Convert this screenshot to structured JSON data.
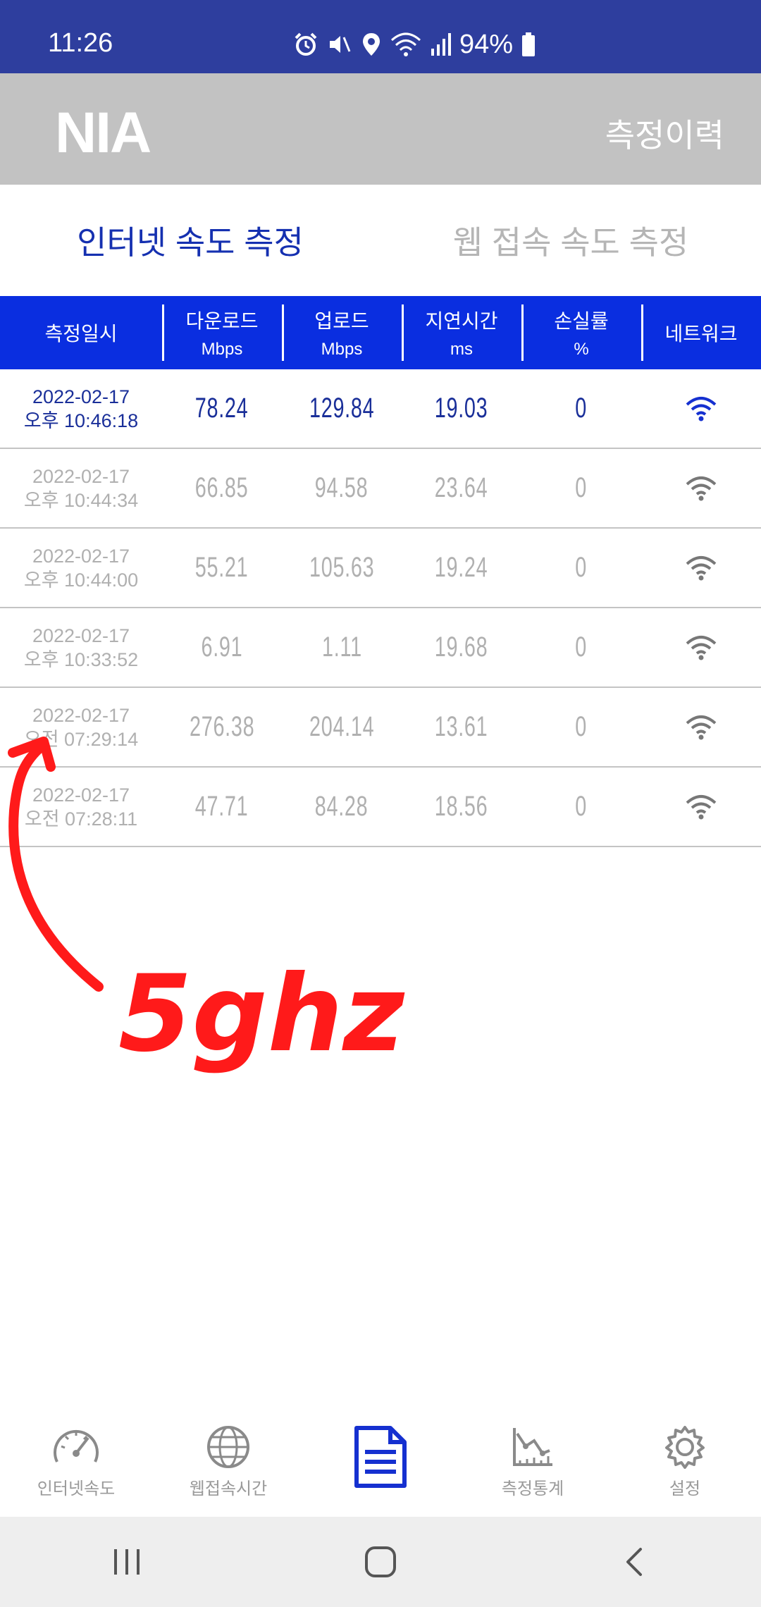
{
  "status_bar": {
    "time": "11:26",
    "battery": "94%",
    "icons": [
      "alarm-icon",
      "mute-icon",
      "location-icon",
      "wifi-icon",
      "signal-icon",
      "battery-icon"
    ]
  },
  "header": {
    "logo": "NIA",
    "title": "측정이력"
  },
  "tabs": [
    {
      "label": "인터넷 속도 측정",
      "active": true
    },
    {
      "label": "웹 접속 속도 측정",
      "active": false
    }
  ],
  "table": {
    "columns": [
      {
        "label": "측정일시",
        "unit": ""
      },
      {
        "label": "다운로드",
        "unit": "Mbps"
      },
      {
        "label": "업로드",
        "unit": "Mbps"
      },
      {
        "label": "지연시간",
        "unit": "ms"
      },
      {
        "label": "손실률",
        "unit": "%"
      },
      {
        "label": "네트워크",
        "unit": ""
      }
    ],
    "rows": [
      {
        "date": "2022-02-17",
        "time": "오후 10:46:18",
        "download": "78.24",
        "upload": "129.84",
        "latency": "19.03",
        "loss": "0",
        "network": "wifi-icon",
        "active": true
      },
      {
        "date": "2022-02-17",
        "time": "오후 10:44:34",
        "download": "66.85",
        "upload": "94.58",
        "latency": "23.64",
        "loss": "0",
        "network": "wifi-icon",
        "active": false
      },
      {
        "date": "2022-02-17",
        "time": "오후 10:44:00",
        "download": "55.21",
        "upload": "105.63",
        "latency": "19.24",
        "loss": "0",
        "network": "wifi-icon",
        "active": false
      },
      {
        "date": "2022-02-17",
        "time": "오후 10:33:52",
        "download": "6.91",
        "upload": "1.11",
        "latency": "19.68",
        "loss": "0",
        "network": "wifi-icon",
        "active": false
      },
      {
        "date": "2022-02-17",
        "time": "오전 07:29:14",
        "download": "276.38",
        "upload": "204.14",
        "latency": "13.61",
        "loss": "0",
        "network": "wifi-icon",
        "active": false
      },
      {
        "date": "2022-02-17",
        "time": "오전 07:28:11",
        "download": "47.71",
        "upload": "84.28",
        "latency": "18.56",
        "loss": "0",
        "network": "wifi-icon",
        "active": false
      }
    ]
  },
  "annotation": {
    "text": "5ghz",
    "color": "#ff1a1a"
  },
  "bottom_nav": [
    {
      "label": "인터넷속도",
      "icon": "speedometer-icon",
      "active": false
    },
    {
      "label": "웹접속시간",
      "icon": "globe-icon",
      "active": false
    },
    {
      "label": "",
      "icon": "document-icon",
      "active": true
    },
    {
      "label": "측정통계",
      "icon": "chart-icon",
      "active": false
    },
    {
      "label": "설정",
      "icon": "gear-icon",
      "active": false
    }
  ],
  "colors": {
    "status_bar": "#2e3e9e",
    "header": "#c2c2c2",
    "accent": "#0a2ee0",
    "active_text": "#1a2f99",
    "inactive_text": "#b0b0b0"
  }
}
